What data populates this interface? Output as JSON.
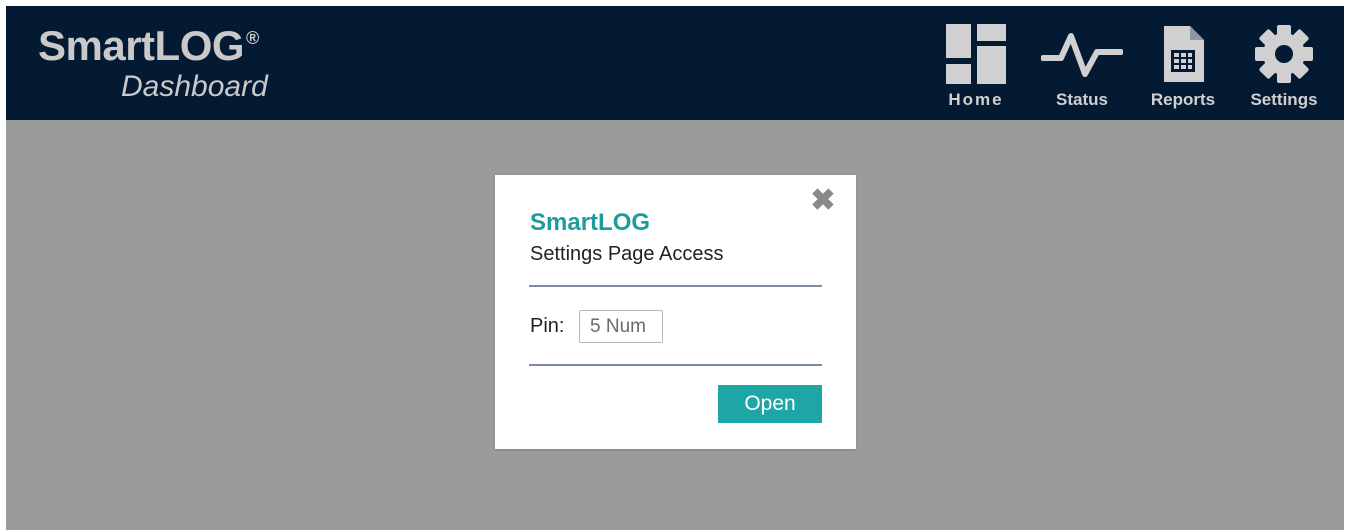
{
  "header": {
    "logo_main": "SmartLOG",
    "logo_registered": "®",
    "logo_sub": "Dashboard",
    "nav": [
      {
        "label": "Home",
        "icon": "home-grid-icon"
      },
      {
        "label": "Status",
        "icon": "pulse-icon"
      },
      {
        "label": "Reports",
        "icon": "document-icon"
      },
      {
        "label": "Settings",
        "icon": "gear-icon"
      }
    ]
  },
  "modal": {
    "title": "SmartLOG",
    "subtitle": "Settings Page Access",
    "pin_label": "Pin:",
    "pin_placeholder": "5 Num",
    "pin_value": "",
    "open_label": "Open",
    "close_symbol": "✖"
  },
  "colors": {
    "header_bg": "#041a33",
    "overlay_bg": "#9b9b9b",
    "accent": "#1ea6a6",
    "title": "#1c9d9c"
  }
}
